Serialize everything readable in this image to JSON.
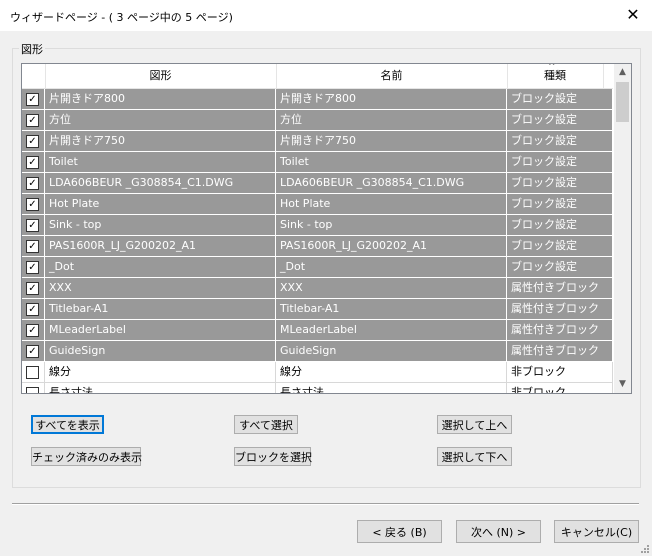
{
  "window": {
    "title": "ウィザードページ - ( 3 ページ中の 5 ページ)",
    "close_glyph": "✕"
  },
  "group": {
    "label": "図形"
  },
  "grid": {
    "columns": [
      "図形",
      "名前",
      "種類"
    ],
    "rows": [
      {
        "checked": true,
        "shape": "片開きドア800",
        "name": "片開きドア800",
        "type": "ブロック設定"
      },
      {
        "checked": true,
        "shape": "方位",
        "name": "方位",
        "type": "ブロック設定"
      },
      {
        "checked": true,
        "shape": "片開きドア750",
        "name": "片開きドア750",
        "type": "ブロック設定"
      },
      {
        "checked": true,
        "shape": "Toilet",
        "name": "Toilet",
        "type": "ブロック設定"
      },
      {
        "checked": true,
        "shape": "LDA606BEUR _G308854_C1.DWG",
        "name": "LDA606BEUR _G308854_C1.DWG",
        "type": "ブロック設定"
      },
      {
        "checked": true,
        "shape": "Hot Plate",
        "name": "Hot Plate",
        "type": "ブロック設定"
      },
      {
        "checked": true,
        "shape": "Sink - top",
        "name": "Sink - top",
        "type": "ブロック設定"
      },
      {
        "checked": true,
        "shape": "PAS1600R_LJ_G200202_A1",
        "name": "PAS1600R_LJ_G200202_A1",
        "type": "ブロック設定"
      },
      {
        "checked": true,
        "shape": "_Dot",
        "name": "_Dot",
        "type": "ブロック設定"
      },
      {
        "checked": true,
        "shape": "XXX",
        "name": "XXX",
        "type": "属性付きブロック"
      },
      {
        "checked": true,
        "shape": "Titlebar-A1",
        "name": "Titlebar-A1",
        "type": "属性付きブロック"
      },
      {
        "checked": true,
        "shape": "MLeaderLabel",
        "name": "MLeaderLabel",
        "type": "属性付きブロック"
      },
      {
        "checked": true,
        "shape": "GuideSign",
        "name": "GuideSign",
        "type": "属性付きブロック"
      },
      {
        "checked": false,
        "shape": "線分",
        "name": "線分",
        "type": "非ブロック"
      },
      {
        "checked": false,
        "shape": "長さ寸法",
        "name": "長さ寸法",
        "type": "非ブロック"
      }
    ],
    "check_glyph": "✓",
    "scroll_up_glyph": "▲",
    "scroll_down_glyph": "▼",
    "sort_glyph": "^"
  },
  "buttons": {
    "show_all": "すべてを表示",
    "select_all": "すべて選択",
    "move_up": "選択して上へ",
    "show_checked": "チェック済みのみ表示",
    "select_blocks": "ブロックを選択",
    "move_down": "選択して下へ"
  },
  "nav": {
    "back": "< 戻る (B)",
    "next": "次へ (N) >",
    "cancel": "キャンセル(C)"
  }
}
